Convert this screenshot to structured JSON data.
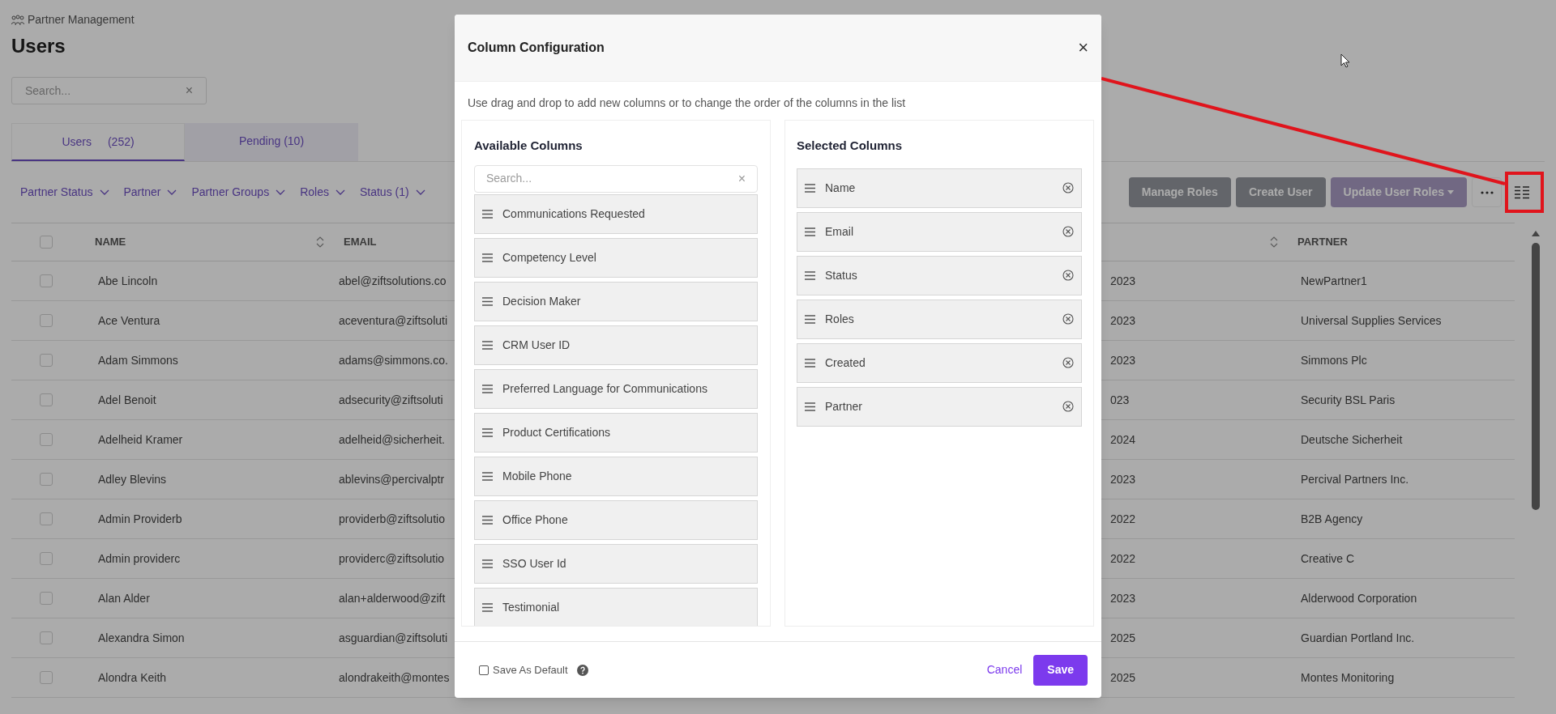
{
  "breadcrumb": "Partner Management",
  "page_title": "Users",
  "search": {
    "placeholder": "Search...",
    "clear": "×"
  },
  "tabs": [
    {
      "label": "Users",
      "count": "(252)",
      "selected": true
    },
    {
      "label": "Pending (10)",
      "selected": false
    }
  ],
  "filters": [
    "Partner Status",
    "Partner",
    "Partner Groups",
    "Roles",
    "Status (1)"
  ],
  "actions": [
    {
      "label": "Manage Roles",
      "disabled": false
    },
    {
      "label": "Create User",
      "disabled": false
    },
    {
      "label": "Update User Roles",
      "disabled": true,
      "dropdown": true
    }
  ],
  "table": {
    "columns": [
      "NAME",
      "EMAIL",
      "PARTNER"
    ],
    "all_checked": false,
    "rows": [
      {
        "name": "Abe Lincoln",
        "email": "abel@ziftsolutions.co",
        "column_3": "2023",
        "partner": "NewPartner1",
        "checked": false
      },
      {
        "name": "Ace Ventura",
        "email": "aceventura@ziftsoluti",
        "column_3": "2023",
        "partner": "Universal Supplies Services",
        "checked": false
      },
      {
        "name": "Adam Simmons",
        "email": "adams@simmons.co.",
        "column_3": "2023",
        "partner": "Simmons Plc",
        "checked": false
      },
      {
        "name": "Adel Benoit",
        "email": "adsecurity@ziftsoluti",
        "column_3": "023",
        "partner": "Security BSL Paris",
        "checked": false
      },
      {
        "name": "Adelheid Kramer",
        "email": "adelheid@sicherheit.",
        "column_3": "2024",
        "partner": "Deutsche Sicherheit",
        "checked": false
      },
      {
        "name": "Adley Blevins",
        "email": "ablevins@percivalptr",
        "column_3": "2023",
        "partner": "Percival Partners Inc.",
        "checked": false
      },
      {
        "name": "Admin Providerb",
        "email": "providerb@ziftsolutio",
        "column_3": "2022",
        "partner": "B2B Agency",
        "checked": false
      },
      {
        "name": "Admin providerc",
        "email": "providerc@ziftsolutio",
        "column_3": "2022",
        "partner": "Creative C",
        "checked": false
      },
      {
        "name": "Alan Alder",
        "email": "alan+alderwood@zift",
        "column_3": "2023",
        "partner": "Alderwood Corporation",
        "checked": false
      },
      {
        "name": "Alexandra Simon",
        "email": "asguardian@ziftsoluti",
        "column_3": "2025",
        "partner": "Guardian Portland Inc.",
        "checked": false
      },
      {
        "name": "Alondra Keith",
        "email": "alondrakeith@montes",
        "column_3": "2025",
        "partner": "Montes Monitoring",
        "checked": false
      }
    ]
  },
  "dialog": {
    "title": "Column Configuration",
    "close": "×",
    "description": "Use drag and drop to add new columns or to change the order of the columns in the list",
    "available": {
      "title": "Available Columns",
      "search_placeholder": "Search...",
      "clear": "×",
      "items": [
        "Communications Requested",
        "Competency Level",
        "Decision Maker",
        "CRM User ID",
        "Preferred Language for Communications",
        "Product Certifications",
        "Mobile Phone",
        "Office Phone",
        "SSO User Id",
        "Testimonial"
      ]
    },
    "selected": {
      "title": "Selected Columns",
      "items": [
        "Name",
        "Email",
        "Status",
        "Roles",
        "Created",
        "Partner"
      ]
    },
    "save_as_default": {
      "label": "Save As Default",
      "checked": false
    },
    "cancel": "Cancel",
    "save": "Save"
  }
}
